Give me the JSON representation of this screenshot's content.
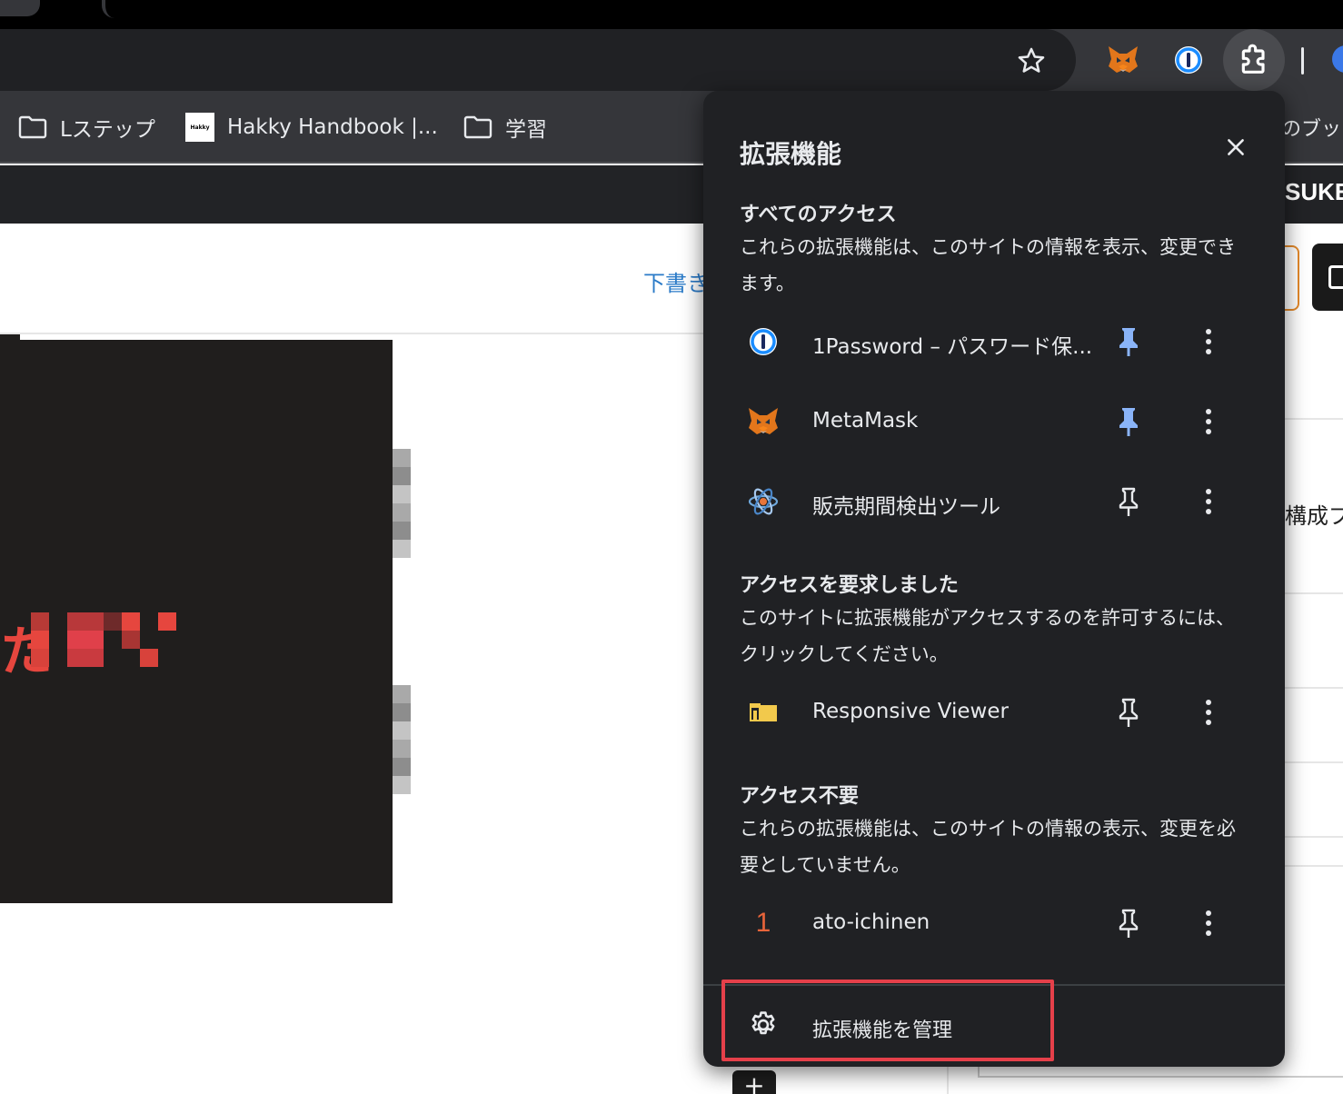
{
  "toolbar": {
    "star_icon": "bookmark-star-icon",
    "extensions": [
      "metamask-fox-icon",
      "onepassword-icon",
      "puzzle-extensions-icon"
    ]
  },
  "bookmarks": {
    "items": [
      {
        "label": "Lステップ",
        "icon": "folder-icon"
      },
      {
        "label": "Hakky Handbook |...",
        "icon": "favicon"
      },
      {
        "label": "学習",
        "icon": "folder-icon"
      }
    ],
    "right_label": "のブッ",
    "favicon_text": "Hakky"
  },
  "page": {
    "header_brand": "SUKE",
    "draft_link": "下書き",
    "right_text": "構成ブ",
    "thumbnail_text": "た"
  },
  "popup": {
    "title": "拡張機能",
    "sections": [
      {
        "title": "すべてのアクセス",
        "desc": "これらの拡張機能は、このサイトの情報を表示、変更できます。",
        "items": [
          {
            "name": "1Password – パスワード保...",
            "pinned": true
          },
          {
            "name": "MetaMask",
            "pinned": true
          },
          {
            "name": "販売期間検出ツール",
            "pinned": false
          }
        ]
      },
      {
        "title": "アクセスを要求しました",
        "desc": "このサイトに拡張機能がアクセスするのを許可するには、クリックしてください。",
        "items": [
          {
            "name": "Responsive Viewer",
            "pinned": false
          }
        ]
      },
      {
        "title": "アクセス不要",
        "desc": "これらの拡張機能は、このサイトの情報の表示、変更を必要としていません。",
        "items": [
          {
            "name": "ato-ichinen",
            "pinned": false,
            "icon_text": "1"
          }
        ]
      }
    ],
    "manage_label": "拡張機能を管理"
  },
  "colors": {
    "popup_bg": "#202124",
    "pin_active": "#8ab4f8",
    "highlight_border": "#e5404a"
  }
}
